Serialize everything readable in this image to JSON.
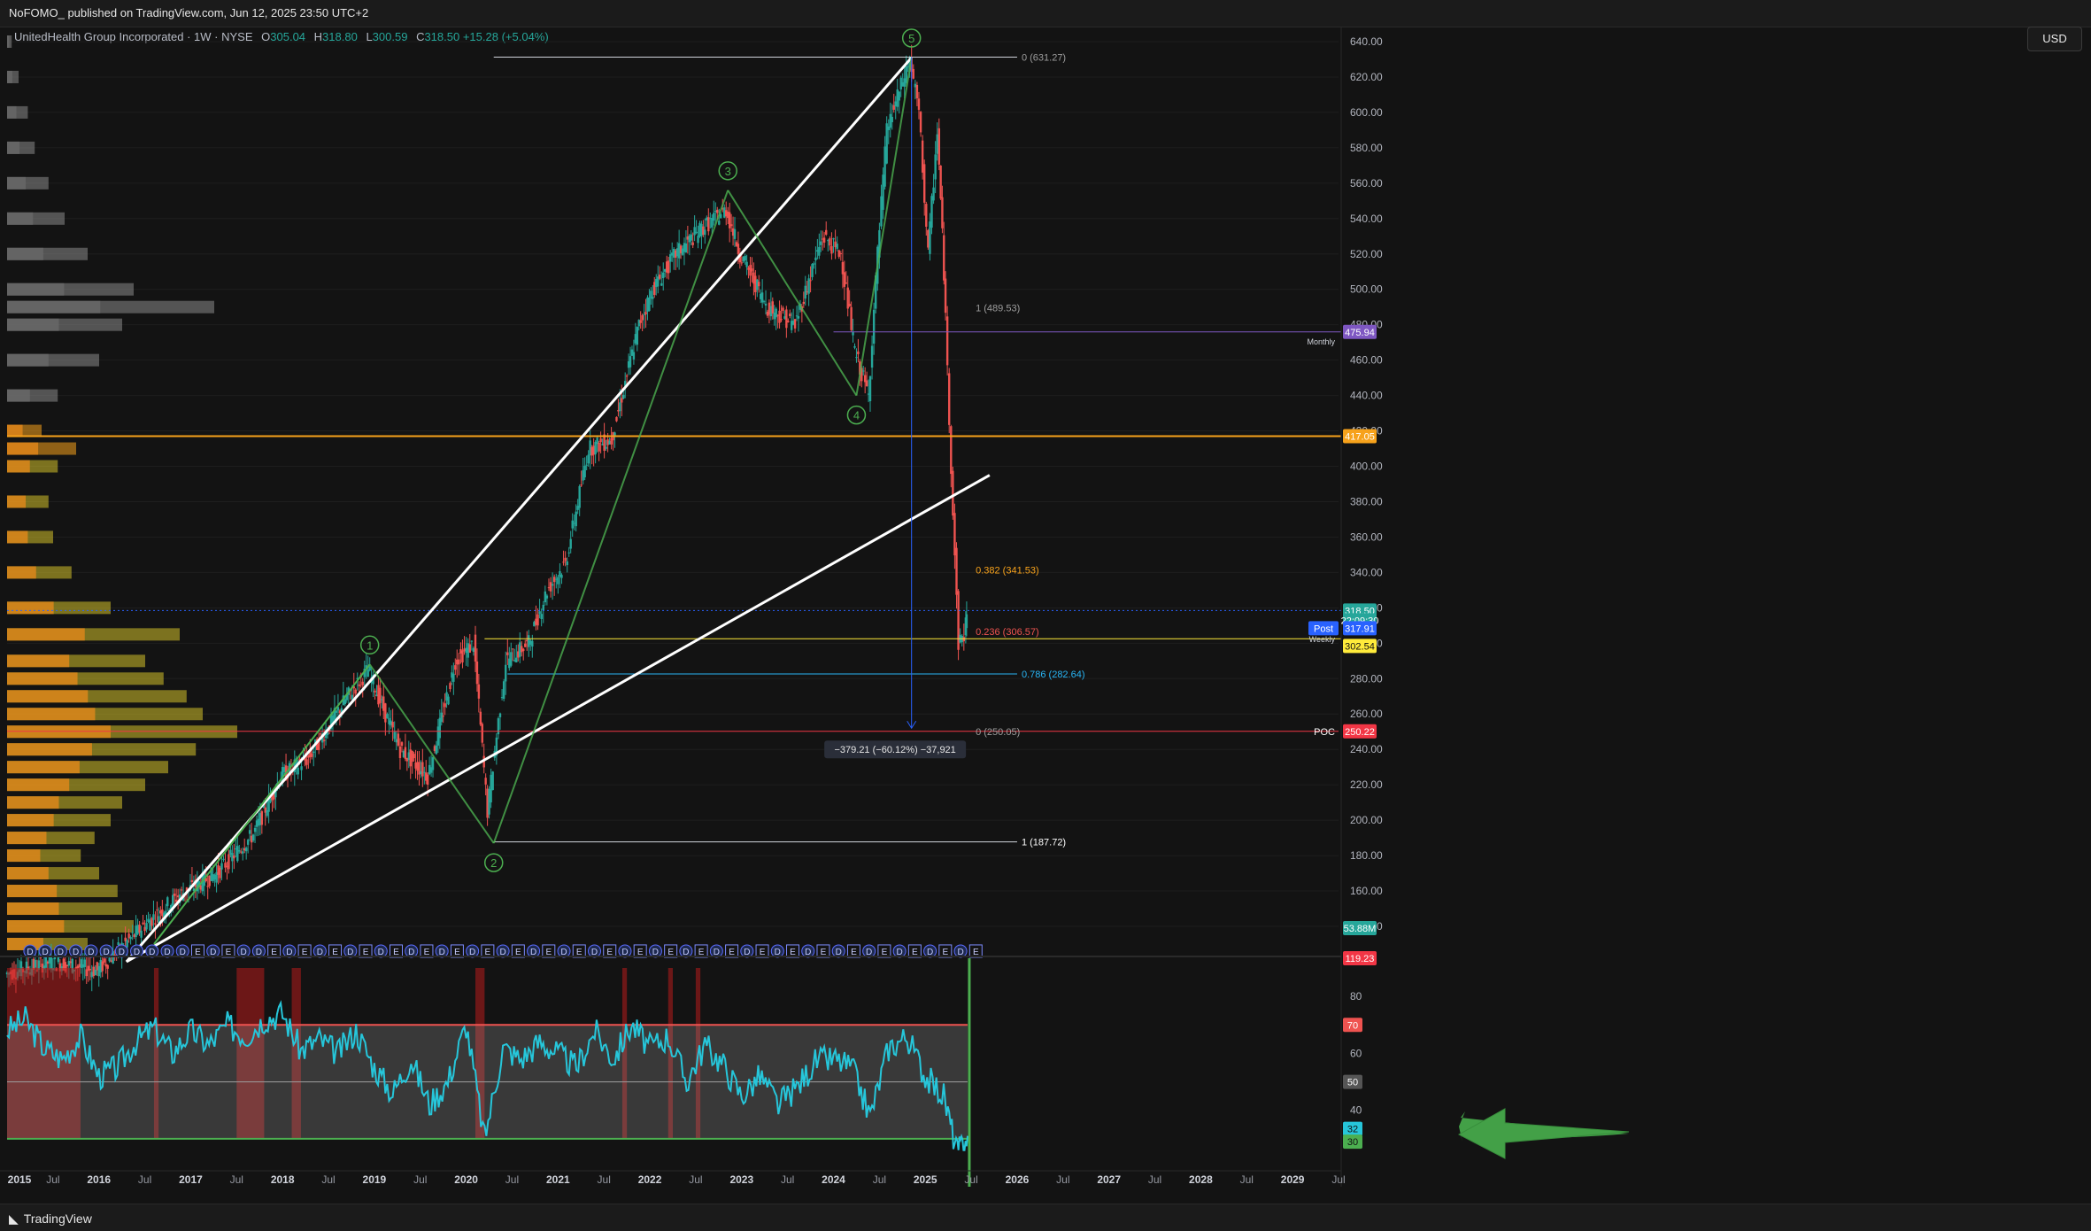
{
  "header": {
    "published": "NoFOMO_ published on TradingView.com, Jun 12, 2025 23:50 UTC+2",
    "symbol": "UnitedHealth Group Incorporated · 1W · NYSE",
    "ohlc": {
      "O": "305.04",
      "H": "318.80",
      "L": "300.59",
      "C": "318.50",
      "change": "+15.28 (+5.04%)"
    },
    "currency": "USD"
  },
  "footer": {
    "brand": "TradingView"
  },
  "colors": {
    "background": "#131313",
    "up": "#26a69a",
    "down": "#ef5350",
    "white_trend": "#ffffff",
    "wave": "#4caf50",
    "orange": "#f7a21b",
    "yellow": "#ffeb3b",
    "purple": "#7e57c2",
    "poc": "#f23645",
    "rsi": "#26c6da",
    "blue_arrow": "#2962ff"
  },
  "chart_data": [
    {
      "type": "candlestick",
      "title": "UnitedHealth Group Incorporated · 1W · NYSE",
      "y_axis": {
        "min": 120,
        "max": 640,
        "ticks": [
          140,
          160,
          180,
          200,
          220,
          240,
          260,
          280,
          300,
          320,
          340,
          360,
          380,
          400,
          420,
          440,
          460,
          480,
          500,
          520,
          540,
          560,
          580,
          600,
          620,
          640
        ]
      },
      "x_axis": {
        "labels": [
          "2015",
          "Jul",
          "2016",
          "Jul",
          "2017",
          "Jul",
          "2018",
          "Jul",
          "2019",
          "Jul",
          "2020",
          "Jul",
          "2021",
          "Jul",
          "2022",
          "Jul",
          "2023",
          "Jul",
          "2024",
          "Jul",
          "2025",
          "Jul",
          "2026",
          "Jul",
          "2027",
          "Jul",
          "2028",
          "Jul",
          "2029",
          "Jul"
        ],
        "year_range": [
          2015.0,
          2029.5
        ]
      },
      "price_path": [
        [
          2015.0,
          113
        ],
        [
          2015.5,
          120
        ],
        [
          2016.0,
          115
        ],
        [
          2016.5,
          140
        ],
        [
          2016.9,
          158
        ],
        [
          2017.3,
          170
        ],
        [
          2017.7,
          192
        ],
        [
          2018.0,
          225
        ],
        [
          2018.3,
          235
        ],
        [
          2018.7,
          268
        ],
        [
          2018.95,
          285
        ],
        [
          2019.1,
          265
        ],
        [
          2019.3,
          240
        ],
        [
          2019.6,
          225
        ],
        [
          2019.9,
          290
        ],
        [
          2020.1,
          300
        ],
        [
          2020.25,
          205
        ],
        [
          2020.45,
          290
        ],
        [
          2020.7,
          300
        ],
        [
          2020.9,
          330
        ],
        [
          2021.1,
          345
        ],
        [
          2021.35,
          410
        ],
        [
          2021.6,
          415
        ],
        [
          2021.9,
          480
        ],
        [
          2022.05,
          500
        ],
        [
          2022.3,
          520
        ],
        [
          2022.6,
          535
        ],
        [
          2022.85,
          545
        ],
        [
          2023.0,
          520
        ],
        [
          2023.3,
          490
        ],
        [
          2023.6,
          480
        ],
        [
          2023.9,
          530
        ],
        [
          2024.1,
          520
        ],
        [
          2024.25,
          465
        ],
        [
          2024.4,
          440
        ],
        [
          2024.5,
          520
        ],
        [
          2024.6,
          590
        ],
        [
          2024.85,
          630
        ],
        [
          2024.95,
          600
        ],
        [
          2025.05,
          520
        ],
        [
          2025.15,
          590
        ],
        [
          2025.22,
          510
        ],
        [
          2025.3,
          400
        ],
        [
          2025.38,
          300
        ],
        [
          2025.44,
          305
        ],
        [
          2025.46,
          318.5
        ]
      ],
      "ohlc_last": {
        "open": 305.04,
        "high": 318.8,
        "low": 300.59,
        "close": 318.5
      },
      "price_labels": [
        {
          "text": "475.94",
          "value": 475.94,
          "color": "#7e57c2"
        },
        {
          "text": "417.05",
          "value": 417.05,
          "color": "#f7a21b"
        },
        {
          "text": "318.50",
          "value": 318.5,
          "color": "#26a69a"
        },
        {
          "text": "22:09:30",
          "value": 313.0,
          "color": "#26a69a"
        },
        {
          "text": "317.91",
          "value": 308.5,
          "color": "#2962ff"
        },
        {
          "text": "302.54",
          "value": 298.5,
          "color": "#ffeb3b"
        },
        {
          "text": "250.22",
          "value": 250.22,
          "color": "#f23645"
        },
        {
          "text": "53.88M",
          "value": 139.0,
          "color": "#26a69a"
        },
        {
          "text": "119.23",
          "value": 122.0,
          "color": "#f23645"
        }
      ],
      "post_label": "Post",
      "weekly_label": "Weekly",
      "monthly_label": "Monthly",
      "poc_label": "POC",
      "horizontal_levels": [
        {
          "value": 631.27,
          "color": "#d1d4dc",
          "from": 2020.3,
          "to": 2026.0
        },
        {
          "value": 475.94,
          "color": "#7e57c2",
          "from": 2024.0,
          "to": 2029.9
        },
        {
          "value": 417.05,
          "color": "#f7a21b",
          "from": 2015.0,
          "to": 2029.9
        },
        {
          "value": 318.5,
          "color": "#2962ff",
          "from": 2015.0,
          "to": 2029.9,
          "dotted": true
        },
        {
          "value": 302.54,
          "color": "#ffeb3b",
          "from": 2020.2,
          "to": 2029.9
        },
        {
          "value": 282.64,
          "color": "#29b6f6",
          "from": 2020.45,
          "to": 2026.0
        },
        {
          "value": 250.22,
          "color": "#f23645",
          "from": 2015.0,
          "to": 2029.5
        },
        {
          "value": 187.72,
          "color": "#d1d4dc",
          "from": 2020.3,
          "to": 2026.0
        }
      ],
      "fib_labels": [
        {
          "text": "0 (631.27)",
          "year": 2026.0,
          "value": 631.27,
          "color": "#9e9e9e"
        },
        {
          "text": "1 (489.53)",
          "year": 2025.5,
          "value": 489.53,
          "color": "#9e9e9e"
        },
        {
          "text": "0.382 (341.53)",
          "year": 2025.5,
          "value": 341.53,
          "color": "#f7a21b"
        },
        {
          "text": "0.236 (306.57)",
          "year": 2025.5,
          "value": 306.57,
          "color": "#ef5350"
        },
        {
          "text": "0.786 (282.64)",
          "year": 2026.0,
          "value": 282.64,
          "color": "#29b6f6"
        },
        {
          "text": "0 (250.05)",
          "year": 2025.5,
          "value": 250.05,
          "color": "#9e9e9e"
        },
        {
          "text": "1 (187.72)",
          "year": 2026.0,
          "value": 187.72,
          "color": "#ffffff"
        }
      ],
      "trendlines": [
        {
          "from": [
            2016.3,
            120
          ],
          "to": [
            2024.85,
            631
          ],
          "color": "#ffffff"
        },
        {
          "from": [
            2016.3,
            120
          ],
          "to": [
            2025.7,
            395
          ],
          "color": "#ffffff"
        },
        {
          "from": [
            2016.6,
            130
          ],
          "to": [
            2018.95,
            288
          ],
          "color": "#4caf50"
        }
      ],
      "elliott_waves": [
        {
          "label": "1",
          "year": 2018.95,
          "value": 288,
          "above": true
        },
        {
          "label": "2",
          "year": 2020.3,
          "value": 187,
          "above": false
        },
        {
          "label": "3",
          "year": 2022.85,
          "value": 556,
          "above": true
        },
        {
          "label": "4",
          "year": 2024.25,
          "value": 440,
          "above": false
        },
        {
          "label": "5",
          "year": 2024.85,
          "value": 631,
          "above": true
        }
      ],
      "measure_label": "−379.21 (−60.12%) −37,921",
      "measure": {
        "year": 2024.85,
        "from": 631.27,
        "to": 252.0
      },
      "earnings_markers": [
        "D",
        "D",
        "D",
        "D",
        "D",
        "D",
        "D",
        "D",
        "D",
        "D",
        "D",
        "E",
        "D",
        "E",
        "D",
        "D",
        "E",
        "D",
        "E",
        "D",
        "E",
        "D",
        "E",
        "D",
        "E",
        "D",
        "E",
        "D",
        "E",
        "D",
        "E",
        "D",
        "E",
        "D",
        "E",
        "D",
        "E",
        "D",
        "E",
        "D",
        "E",
        "D",
        "E",
        "D",
        "E",
        "D",
        "E",
        "D",
        "E",
        "D",
        "E",
        "D",
        "E",
        "D",
        "E",
        "D",
        "E",
        "D",
        "E",
        "D",
        "E",
        "D",
        "E"
      ],
      "volume_profile": [
        {
          "value": 640,
          "size": 0.02
        },
        {
          "value": 620,
          "size": 0.05
        },
        {
          "value": 600,
          "size": 0.09
        },
        {
          "value": 580,
          "size": 0.12
        },
        {
          "value": 560,
          "size": 0.18
        },
        {
          "value": 540,
          "size": 0.25
        },
        {
          "value": 520,
          "size": 0.35
        },
        {
          "value": 500,
          "size": 0.55
        },
        {
          "value": 490,
          "size": 0.9
        },
        {
          "value": 480,
          "size": 0.5
        },
        {
          "value": 460,
          "size": 0.4
        },
        {
          "value": 440,
          "size": 0.22
        },
        {
          "value": 420,
          "size": 0.15
        },
        {
          "value": 410,
          "size": 0.3
        },
        {
          "value": 400,
          "size": 0.22
        },
        {
          "value": 380,
          "size": 0.18
        },
        {
          "value": 360,
          "size": 0.2
        },
        {
          "value": 340,
          "size": 0.28
        },
        {
          "value": 320,
          "size": 0.45
        },
        {
          "value": 305,
          "size": 0.75
        },
        {
          "value": 290,
          "size": 0.6
        },
        {
          "value": 280,
          "size": 0.68
        },
        {
          "value": 270,
          "size": 0.78
        },
        {
          "value": 260,
          "size": 0.85
        },
        {
          "value": 250,
          "size": 1.0
        },
        {
          "value": 240,
          "size": 0.82
        },
        {
          "value": 230,
          "size": 0.7
        },
        {
          "value": 220,
          "size": 0.6
        },
        {
          "value": 210,
          "size": 0.5
        },
        {
          "value": 200,
          "size": 0.45
        },
        {
          "value": 190,
          "size": 0.38
        },
        {
          "value": 180,
          "size": 0.32
        },
        {
          "value": 170,
          "size": 0.4
        },
        {
          "value": 160,
          "size": 0.48
        },
        {
          "value": 150,
          "size": 0.5
        },
        {
          "value": 140,
          "size": 0.55
        },
        {
          "value": 130,
          "size": 0.35
        }
      ]
    },
    {
      "type": "line",
      "title": "RSI",
      "y_axis": {
        "min": 20,
        "max": 90,
        "ticks": [
          30,
          40,
          50,
          60,
          70,
          80
        ]
      },
      "bands": {
        "upper": 70,
        "middle": 50,
        "lower": 30
      },
      "x": [
        2015.0,
        2015.2,
        2015.4,
        2015.6,
        2015.8,
        2016.0,
        2016.2,
        2016.4,
        2016.6,
        2016.8,
        2017.0,
        2017.2,
        2017.4,
        2017.6,
        2017.8,
        2018.0,
        2018.2,
        2018.4,
        2018.6,
        2018.8,
        2019.0,
        2019.2,
        2019.4,
        2019.6,
        2019.8,
        2020.0,
        2020.2,
        2020.4,
        2020.6,
        2020.8,
        2021.0,
        2021.2,
        2021.4,
        2021.6,
        2021.8,
        2022.0,
        2022.2,
        2022.4,
        2022.6,
        2022.8,
        2023.0,
        2023.2,
        2023.4,
        2023.6,
        2023.8,
        2024.0,
        2024.2,
        2024.4,
        2024.6,
        2024.8,
        2025.0,
        2025.2,
        2025.35,
        2025.46
      ],
      "values": [
        68,
        72,
        62,
        58,
        66,
        52,
        55,
        64,
        69,
        60,
        68,
        63,
        70,
        66,
        72,
        74,
        61,
        65,
        60,
        68,
        55,
        46,
        58,
        42,
        50,
        70,
        30,
        62,
        58,
        64,
        60,
        55,
        68,
        58,
        70,
        62,
        66,
        50,
        63,
        56,
        45,
        52,
        42,
        48,
        57,
        58,
        55,
        38,
        62,
        66,
        52,
        45,
        25,
        31
      ],
      "latest": {
        "rsi": "32",
        "signal": "30"
      },
      "overbought_periods": [
        [
          2015.0,
          2015.8
        ],
        [
          2016.6,
          2016.65
        ],
        [
          2017.5,
          2017.8
        ],
        [
          2018.1,
          2018.2
        ],
        [
          2020.1,
          2020.2
        ],
        [
          2021.7,
          2021.75
        ],
        [
          2022.2,
          2022.25
        ],
        [
          2022.5,
          2022.55
        ]
      ]
    }
  ]
}
